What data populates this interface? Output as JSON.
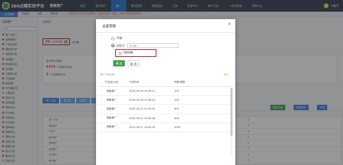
{
  "topbar": {
    "logo_text": "360点睛实效平台",
    "product": "搜索推广",
    "nav": [
      "首页",
      "我的账户",
      "推广",
      "素材管理",
      "数据报告",
      "工具",
      "资源中心",
      "新手引导",
      "一体化投放",
      "帮助中心"
    ],
    "active_nav_index": 2,
    "user_name": "小助手"
  },
  "subbar": {
    "tabs": [
      "实时管理",
      "关键词",
      "创意",
      "规划师"
    ],
    "active_index": 0,
    "notice": "您的某个计划已达到预算，可能影响推广效果，请及时调整预算设置"
  },
  "sidebar": {
    "title": "全部推广",
    "search_placeholder": "搜索",
    "items": [
      {
        "label": "推广计划一",
        "status": "red"
      },
      {
        "label": "品牌词推广",
        "status": "green"
      },
      {
        "label": "产品词计划",
        "status": "red"
      },
      {
        "label": "通用词计划",
        "status": "red"
      },
      {
        "label": "竞品词计划",
        "status": "gray"
      },
      {
        "label": "地域推广",
        "status": "red"
      },
      {
        "label": "移动端计划",
        "status": "red"
      },
      {
        "label": "活动推广",
        "status": "red"
      },
      {
        "label": "长尾词计划",
        "status": "green"
      },
      {
        "label": "节日促销",
        "status": "red"
      },
      {
        "label": "新品推广",
        "status": "red"
      },
      {
        "label": "行业通用词",
        "status": "red"
      },
      {
        "label": "人群定向",
        "status": "gray"
      },
      {
        "label": "测试计划",
        "status": "red"
      },
      {
        "label": "招商加盟",
        "status": "red"
      },
      {
        "label": "夜间计划",
        "status": "red"
      },
      {
        "label": "华东地区",
        "status": "red"
      },
      {
        "label": "华南地区",
        "status": "green"
      },
      {
        "label": "华北地区",
        "status": "red"
      },
      {
        "label": "西南地区",
        "status": "red"
      },
      {
        "label": "品牌专区",
        "status": "red"
      },
      {
        "label": "暂停计划",
        "status": "gray"
      },
      {
        "label": "其他计划",
        "status": "red"
      },
      {
        "label": "新建计划",
        "status": "red"
      },
      {
        "label": "默认计划",
        "status": "red"
      },
      {
        "label": "备用计划",
        "status": "red"
      },
      {
        "label": "历史计划",
        "status": "gray"
      },
      {
        "label": "计划二十八",
        "status": "red"
      }
    ]
  },
  "main": {
    "breadcrumb": "全部推广",
    "budget_label": "预算",
    "budget_value": "¥ 100/天",
    "budget_extra": "不可用",
    "card_left_title": "重点词优化建议",
    "card_left_value": "6439",
    "card_left_text": "个关键词可优化",
    "card_left_value2": "3",
    "card_left_text2": "个计划预算不足",
    "tabs": [
      "推广计划",
      "推广组",
      "关键词",
      "创意",
      "附加创意"
    ],
    "right_buttons": [
      "添加计划",
      "批量操作",
      "下载"
    ],
    "rows": [
      [
        "推广计划",
        "有效",
        "4774992",
        "¥100.00",
        "0",
        "0"
      ],
      [
        "搜索推广",
        "有效",
        "4775001",
        "¥80.00",
        "0",
        "0"
      ],
      [
        "PC推广",
        "暂停",
        "4775012",
        "¥50.00",
        "0",
        "0"
      ],
      [
        "移动推广",
        "有效",
        "4775020",
        "¥120.00",
        "0",
        "0"
      ],
      [
        "品牌推广",
        "有效",
        "4775031",
        "¥200.00",
        "0",
        "0"
      ],
      [
        "地域推广",
        "有效",
        "4775040",
        "¥60.00",
        "0",
        "0"
      ],
      [
        "活动推广",
        "有效",
        "4775052",
        "¥90.00",
        "0",
        "0"
      ],
      [
        "夜间推广",
        "暂停",
        "4775063",
        "¥30.00",
        "0",
        "0"
      ]
    ]
  },
  "modal": {
    "title": "设置预算",
    "option_unlimited": "不限",
    "option_custom": "自定义",
    "amount_value": "¥ 100",
    "warn_label": "预算预警",
    "ok_label": "确 定",
    "cancel_label": "取 消",
    "log_title": "账户下线记录",
    "log_link": "更多",
    "log_headers": [
      "产品线/计划",
      "下线时间",
      "预算/预警"
    ],
    "log_rows": [
      [
        "搜索推广",
        "2024-05-30 19:26:21",
        "100"
      ],
      [
        "搜索推广",
        "2024-05-28 11:58:15",
        "100"
      ],
      [
        "搜索推广",
        "2022-09-22 02:53:52",
        "400"
      ],
      [
        "搜索推广",
        "2022-09-21 10:03:28",
        "400"
      ],
      [
        "搜索推广",
        "2022-09-21 10:03:20",
        "2000"
      ]
    ]
  },
  "colors": {
    "topbar": "#2f3b4c",
    "accent": "#3d7ee0",
    "ok_green": "#3fa14a",
    "highlight_red": "#d0021b"
  }
}
